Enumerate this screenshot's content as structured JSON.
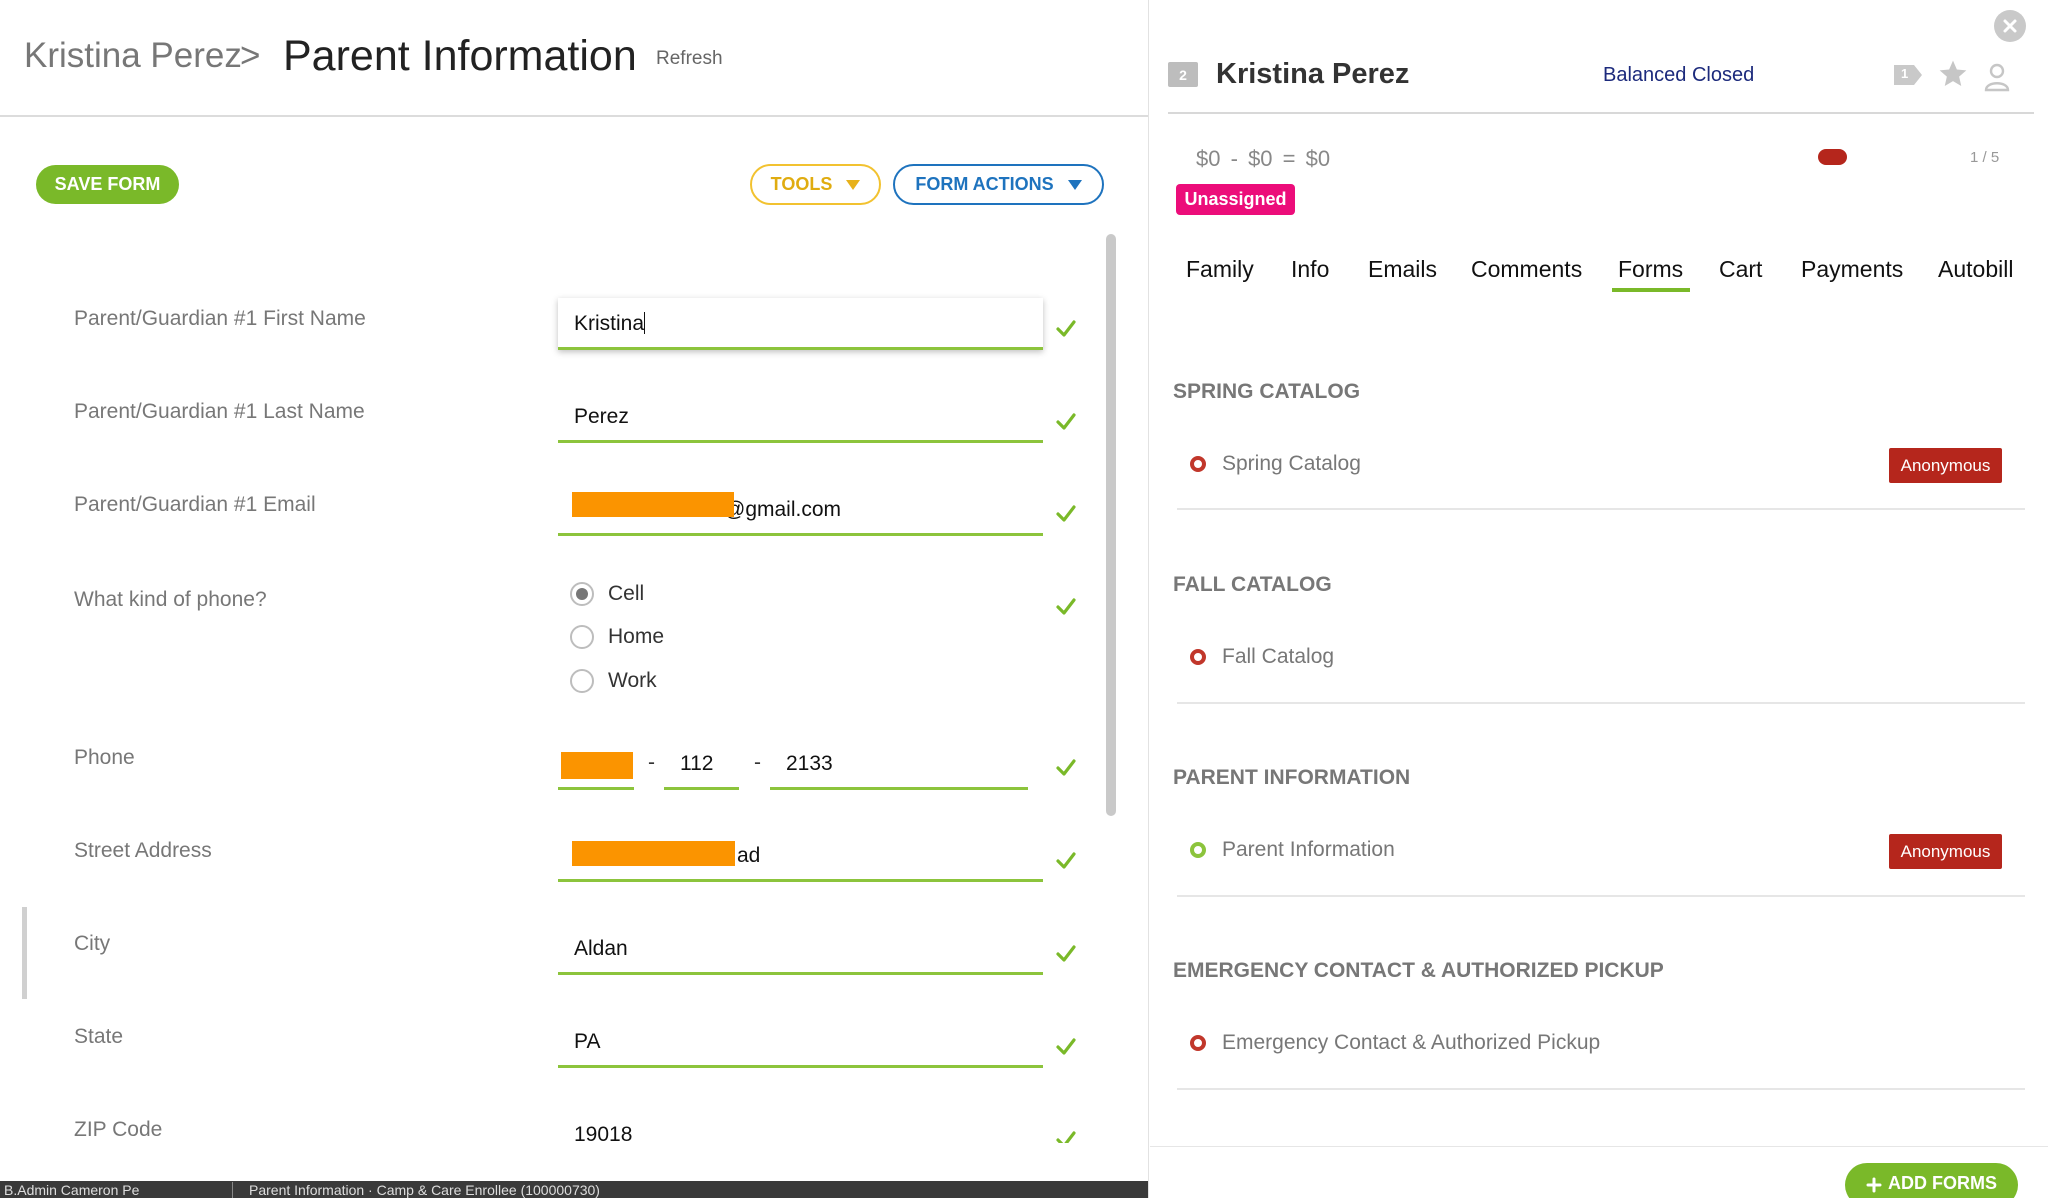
{
  "breadcrumb": {
    "parent": "Kristina Perez",
    "separator": ">",
    "current": "Parent Information"
  },
  "header": {
    "refresh_label": "Refresh"
  },
  "toolbar": {
    "save_label": "SAVE FORM",
    "tools_label": "TOOLS",
    "form_actions_label": "FORM ACTIONS"
  },
  "form": {
    "first_name": {
      "label": "Parent/Guardian #1 First Name",
      "value": "Kristina"
    },
    "last_name": {
      "label": "Parent/Guardian #1 Last Name",
      "value": "Perez"
    },
    "email": {
      "label": "Parent/Guardian #1 Email",
      "value": "@gmail.com"
    },
    "phone_kind": {
      "label": "What kind of phone?",
      "options": [
        "Cell",
        "Home",
        "Work"
      ],
      "selected": "Cell"
    },
    "phone": {
      "label": "Phone",
      "separator": "-",
      "prefix": "112",
      "line": "2133"
    },
    "street": {
      "label": "Street Address",
      "value": "ad"
    },
    "city": {
      "label": "City",
      "value": "Aldan"
    },
    "state": {
      "label": "State",
      "value": "PA"
    },
    "zip": {
      "label": "ZIP Code",
      "value": "19018"
    }
  },
  "statusbar": {
    "left": "B.Admin  Cameron Pe",
    "right": "Parent Information · Camp & Care Enrollee (100000730)"
  },
  "family": {
    "id_badge": "2",
    "name": "Kristina Perez",
    "balance_status": "Balanced Closed",
    "tag_count": "1",
    "balance_a": "$0",
    "balance_b": "$0",
    "balance_total": "$0",
    "op_minus": "-",
    "op_equals": "=",
    "pager": "1 / 5",
    "assignment": "Unassigned"
  },
  "tabs": [
    "Family",
    "Info",
    "Emails",
    "Comments",
    "Forms",
    "Cart",
    "Payments",
    "Autobill"
  ],
  "active_tab": "Forms",
  "sections": [
    {
      "title": "SPRING CATALOG",
      "item": "Spring Catalog",
      "badge": "Anonymous",
      "status_color": "#c1372b"
    },
    {
      "title": "FALL CATALOG",
      "item": "Fall Catalog",
      "badge": "",
      "status_color": "#c1372b"
    },
    {
      "title": "PARENT INFORMATION",
      "item": "Parent Information",
      "badge": "Anonymous",
      "status_color": "#8cc43c"
    },
    {
      "title": "EMERGENCY CONTACT & AUTHORIZED PICKUP",
      "item": "Emergency Contact & Authorized Pickup",
      "badge": "",
      "status_color": "#c1372b"
    }
  ],
  "add_forms_label": "ADD FORMS",
  "colors": {
    "accent_green": "#7ab929",
    "field_underline": "#8cc43c",
    "tools_yellow": "#f2c230",
    "action_blue": "#1e73be",
    "badge_red": "#b5261c",
    "unassigned_pink": "#ec0d7a",
    "redaction_orange": "#fb9400"
  },
  "icons": [
    "chevron-right-icon",
    "caret-down-icon",
    "check-icon",
    "close-icon",
    "tag-icon",
    "star-icon",
    "user-icon",
    "status-ring-icon",
    "plus-icon"
  ]
}
